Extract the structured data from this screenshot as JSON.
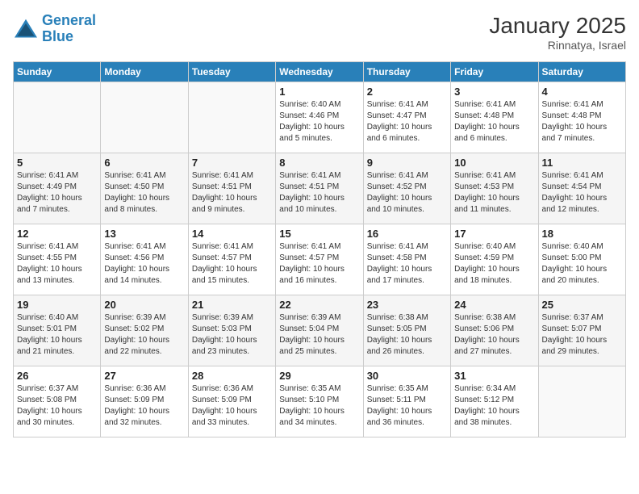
{
  "header": {
    "logo_line1": "General",
    "logo_line2": "Blue",
    "title": "January 2025",
    "subtitle": "Rinnatya, Israel"
  },
  "weekdays": [
    "Sunday",
    "Monday",
    "Tuesday",
    "Wednesday",
    "Thursday",
    "Friday",
    "Saturday"
  ],
  "weeks": [
    [
      {
        "day": "",
        "info": ""
      },
      {
        "day": "",
        "info": ""
      },
      {
        "day": "",
        "info": ""
      },
      {
        "day": "1",
        "info": "Sunrise: 6:40 AM\nSunset: 4:46 PM\nDaylight: 10 hours\nand 5 minutes."
      },
      {
        "day": "2",
        "info": "Sunrise: 6:41 AM\nSunset: 4:47 PM\nDaylight: 10 hours\nand 6 minutes."
      },
      {
        "day": "3",
        "info": "Sunrise: 6:41 AM\nSunset: 4:48 PM\nDaylight: 10 hours\nand 6 minutes."
      },
      {
        "day": "4",
        "info": "Sunrise: 6:41 AM\nSunset: 4:48 PM\nDaylight: 10 hours\nand 7 minutes."
      }
    ],
    [
      {
        "day": "5",
        "info": "Sunrise: 6:41 AM\nSunset: 4:49 PM\nDaylight: 10 hours\nand 7 minutes."
      },
      {
        "day": "6",
        "info": "Sunrise: 6:41 AM\nSunset: 4:50 PM\nDaylight: 10 hours\nand 8 minutes."
      },
      {
        "day": "7",
        "info": "Sunrise: 6:41 AM\nSunset: 4:51 PM\nDaylight: 10 hours\nand 9 minutes."
      },
      {
        "day": "8",
        "info": "Sunrise: 6:41 AM\nSunset: 4:51 PM\nDaylight: 10 hours\nand 10 minutes."
      },
      {
        "day": "9",
        "info": "Sunrise: 6:41 AM\nSunset: 4:52 PM\nDaylight: 10 hours\nand 10 minutes."
      },
      {
        "day": "10",
        "info": "Sunrise: 6:41 AM\nSunset: 4:53 PM\nDaylight: 10 hours\nand 11 minutes."
      },
      {
        "day": "11",
        "info": "Sunrise: 6:41 AM\nSunset: 4:54 PM\nDaylight: 10 hours\nand 12 minutes."
      }
    ],
    [
      {
        "day": "12",
        "info": "Sunrise: 6:41 AM\nSunset: 4:55 PM\nDaylight: 10 hours\nand 13 minutes."
      },
      {
        "day": "13",
        "info": "Sunrise: 6:41 AM\nSunset: 4:56 PM\nDaylight: 10 hours\nand 14 minutes."
      },
      {
        "day": "14",
        "info": "Sunrise: 6:41 AM\nSunset: 4:57 PM\nDaylight: 10 hours\nand 15 minutes."
      },
      {
        "day": "15",
        "info": "Sunrise: 6:41 AM\nSunset: 4:57 PM\nDaylight: 10 hours\nand 16 minutes."
      },
      {
        "day": "16",
        "info": "Sunrise: 6:41 AM\nSunset: 4:58 PM\nDaylight: 10 hours\nand 17 minutes."
      },
      {
        "day": "17",
        "info": "Sunrise: 6:40 AM\nSunset: 4:59 PM\nDaylight: 10 hours\nand 18 minutes."
      },
      {
        "day": "18",
        "info": "Sunrise: 6:40 AM\nSunset: 5:00 PM\nDaylight: 10 hours\nand 20 minutes."
      }
    ],
    [
      {
        "day": "19",
        "info": "Sunrise: 6:40 AM\nSunset: 5:01 PM\nDaylight: 10 hours\nand 21 minutes."
      },
      {
        "day": "20",
        "info": "Sunrise: 6:39 AM\nSunset: 5:02 PM\nDaylight: 10 hours\nand 22 minutes."
      },
      {
        "day": "21",
        "info": "Sunrise: 6:39 AM\nSunset: 5:03 PM\nDaylight: 10 hours\nand 23 minutes."
      },
      {
        "day": "22",
        "info": "Sunrise: 6:39 AM\nSunset: 5:04 PM\nDaylight: 10 hours\nand 25 minutes."
      },
      {
        "day": "23",
        "info": "Sunrise: 6:38 AM\nSunset: 5:05 PM\nDaylight: 10 hours\nand 26 minutes."
      },
      {
        "day": "24",
        "info": "Sunrise: 6:38 AM\nSunset: 5:06 PM\nDaylight: 10 hours\nand 27 minutes."
      },
      {
        "day": "25",
        "info": "Sunrise: 6:37 AM\nSunset: 5:07 PM\nDaylight: 10 hours\nand 29 minutes."
      }
    ],
    [
      {
        "day": "26",
        "info": "Sunrise: 6:37 AM\nSunset: 5:08 PM\nDaylight: 10 hours\nand 30 minutes."
      },
      {
        "day": "27",
        "info": "Sunrise: 6:36 AM\nSunset: 5:09 PM\nDaylight: 10 hours\nand 32 minutes."
      },
      {
        "day": "28",
        "info": "Sunrise: 6:36 AM\nSunset: 5:09 PM\nDaylight: 10 hours\nand 33 minutes."
      },
      {
        "day": "29",
        "info": "Sunrise: 6:35 AM\nSunset: 5:10 PM\nDaylight: 10 hours\nand 34 minutes."
      },
      {
        "day": "30",
        "info": "Sunrise: 6:35 AM\nSunset: 5:11 PM\nDaylight: 10 hours\nand 36 minutes."
      },
      {
        "day": "31",
        "info": "Sunrise: 6:34 AM\nSunset: 5:12 PM\nDaylight: 10 hours\nand 38 minutes."
      },
      {
        "day": "",
        "info": ""
      }
    ]
  ]
}
